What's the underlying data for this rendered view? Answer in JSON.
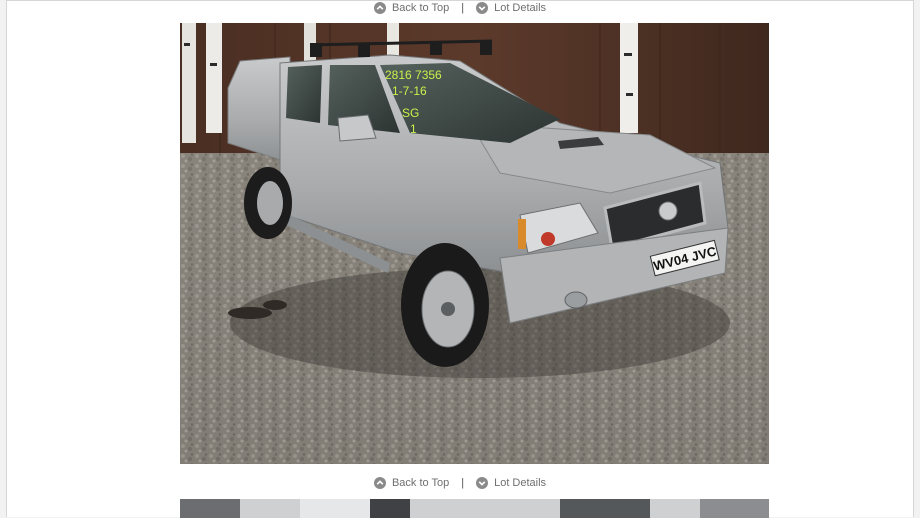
{
  "nav_top": {
    "back_to_top": "Back to Top",
    "separator": "|",
    "lot_details": "Lot Details",
    "back_icon": "chevron-up-circle-icon",
    "lot_icon": "chevron-down-circle-icon"
  },
  "nav_mid": {
    "back_to_top": "Back to Top",
    "separator": "|",
    "lot_details": "Lot Details",
    "back_icon": "chevron-up-circle-icon",
    "lot_icon": "chevron-down-circle-icon"
  },
  "photo_main": {
    "plate": "WV04 JVC",
    "windscreen_note_1": "2816 7356",
    "windscreen_note_2": "1-7-16",
    "windscreen_note_3": "SG",
    "windscreen_note_4": "1"
  },
  "colors": {
    "link": "#6f6f6f",
    "icon": "#8a8a8a"
  }
}
